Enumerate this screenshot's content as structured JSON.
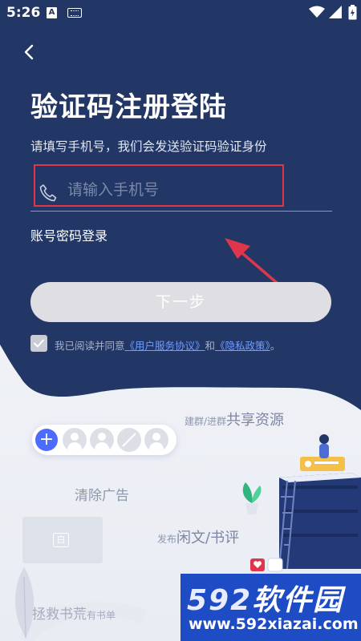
{
  "status_bar": {
    "time": "5:26",
    "badge_letter": "A"
  },
  "header": {
    "title": "验证码注册登陆",
    "subtitle": "请填写手机号，我们会发送验证码验证身份"
  },
  "phone": {
    "placeholder": "请输入手机号",
    "value": ""
  },
  "password_login_label": "账号密码登录",
  "next_button_label": "下一步",
  "agreement": {
    "checked": true,
    "prefix": "我已阅读并同意",
    "user_agreement_link": "《用户服务协议》",
    "and": "和",
    "privacy_link": "《隐私政策》",
    "suffix": "。"
  },
  "illustration": {
    "share_prefix": "建群/进群",
    "share_main": "共享资源",
    "clear_ads": "清除广告",
    "publish_prefix": "发布",
    "publish_main": "闲文/书评",
    "rescue_main": "拯救书荒",
    "rescue_suffix": "有书单",
    "panel_glyph": "白"
  },
  "watermark": {
    "number": "592",
    "brand": "软件园",
    "url": "www.592xiazai.com"
  },
  "colors": {
    "header_bg": "#223766",
    "annotation_red": "#e0354a",
    "link_blue": "#6f9cff",
    "button_disabled": "#dfdfe3",
    "watermark_bg": "#1e4cc4"
  }
}
